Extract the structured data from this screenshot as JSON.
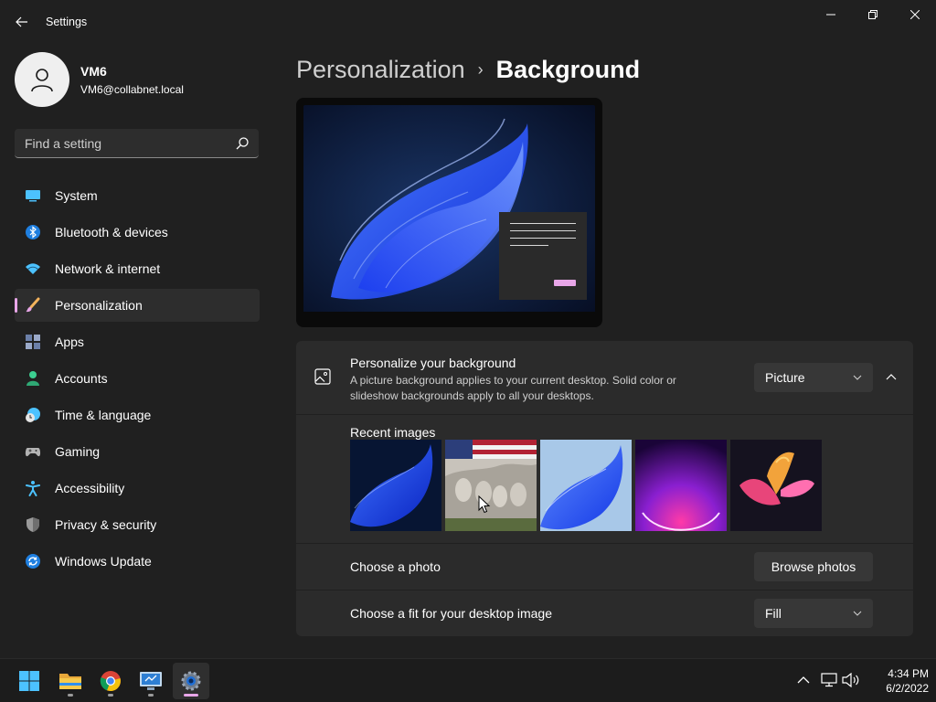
{
  "window": {
    "title": "Settings"
  },
  "user": {
    "name": "VM6",
    "email": "VM6@collabnet.local"
  },
  "search": {
    "placeholder": "Find a setting"
  },
  "sidebar": {
    "items": [
      {
        "label": "System",
        "icon": "system-icon"
      },
      {
        "label": "Bluetooth & devices",
        "icon": "bluetooth-icon"
      },
      {
        "label": "Network & internet",
        "icon": "wifi-icon"
      },
      {
        "label": "Personalization",
        "icon": "brush-icon",
        "selected": true
      },
      {
        "label": "Apps",
        "icon": "apps-icon"
      },
      {
        "label": "Accounts",
        "icon": "person-icon"
      },
      {
        "label": "Time & language",
        "icon": "clock-globe-icon"
      },
      {
        "label": "Gaming",
        "icon": "gamepad-icon"
      },
      {
        "label": "Accessibility",
        "icon": "accessibility-icon"
      },
      {
        "label": "Privacy & security",
        "icon": "shield-icon"
      },
      {
        "label": "Windows Update",
        "icon": "update-icon"
      }
    ]
  },
  "breadcrumb": {
    "parent": "Personalization",
    "separator": "›",
    "current": "Background"
  },
  "background": {
    "title": "Personalize your background",
    "description": "A picture background applies to your current desktop. Solid color or slideshow backgrounds apply to all your desktops.",
    "type_value": "Picture",
    "recent_label": "Recent images",
    "recent_images": [
      "windows-bloom-dark",
      "mount-rushmore-flag",
      "windows-bloom-light",
      "purple-glow-arc",
      "pink-flower-abstract"
    ],
    "choose_photo_label": "Choose a photo",
    "browse_button": "Browse photos",
    "fit_label": "Choose a fit for your desktop image",
    "fit_value": "Fill"
  },
  "taskbar": {
    "apps": [
      "windows-start-icon",
      "file-explorer-icon",
      "chrome-icon",
      "remote-desktop-icon",
      "settings-gear-icon"
    ],
    "tray": [
      "chevron-up-icon",
      "network-icon",
      "volume-icon"
    ],
    "time": "4:34 PM",
    "date": "6/2/2022"
  },
  "colors": {
    "background": "#202020",
    "card": "#2b2b2b",
    "accent": "#e8a6e8",
    "control": "#373737"
  }
}
